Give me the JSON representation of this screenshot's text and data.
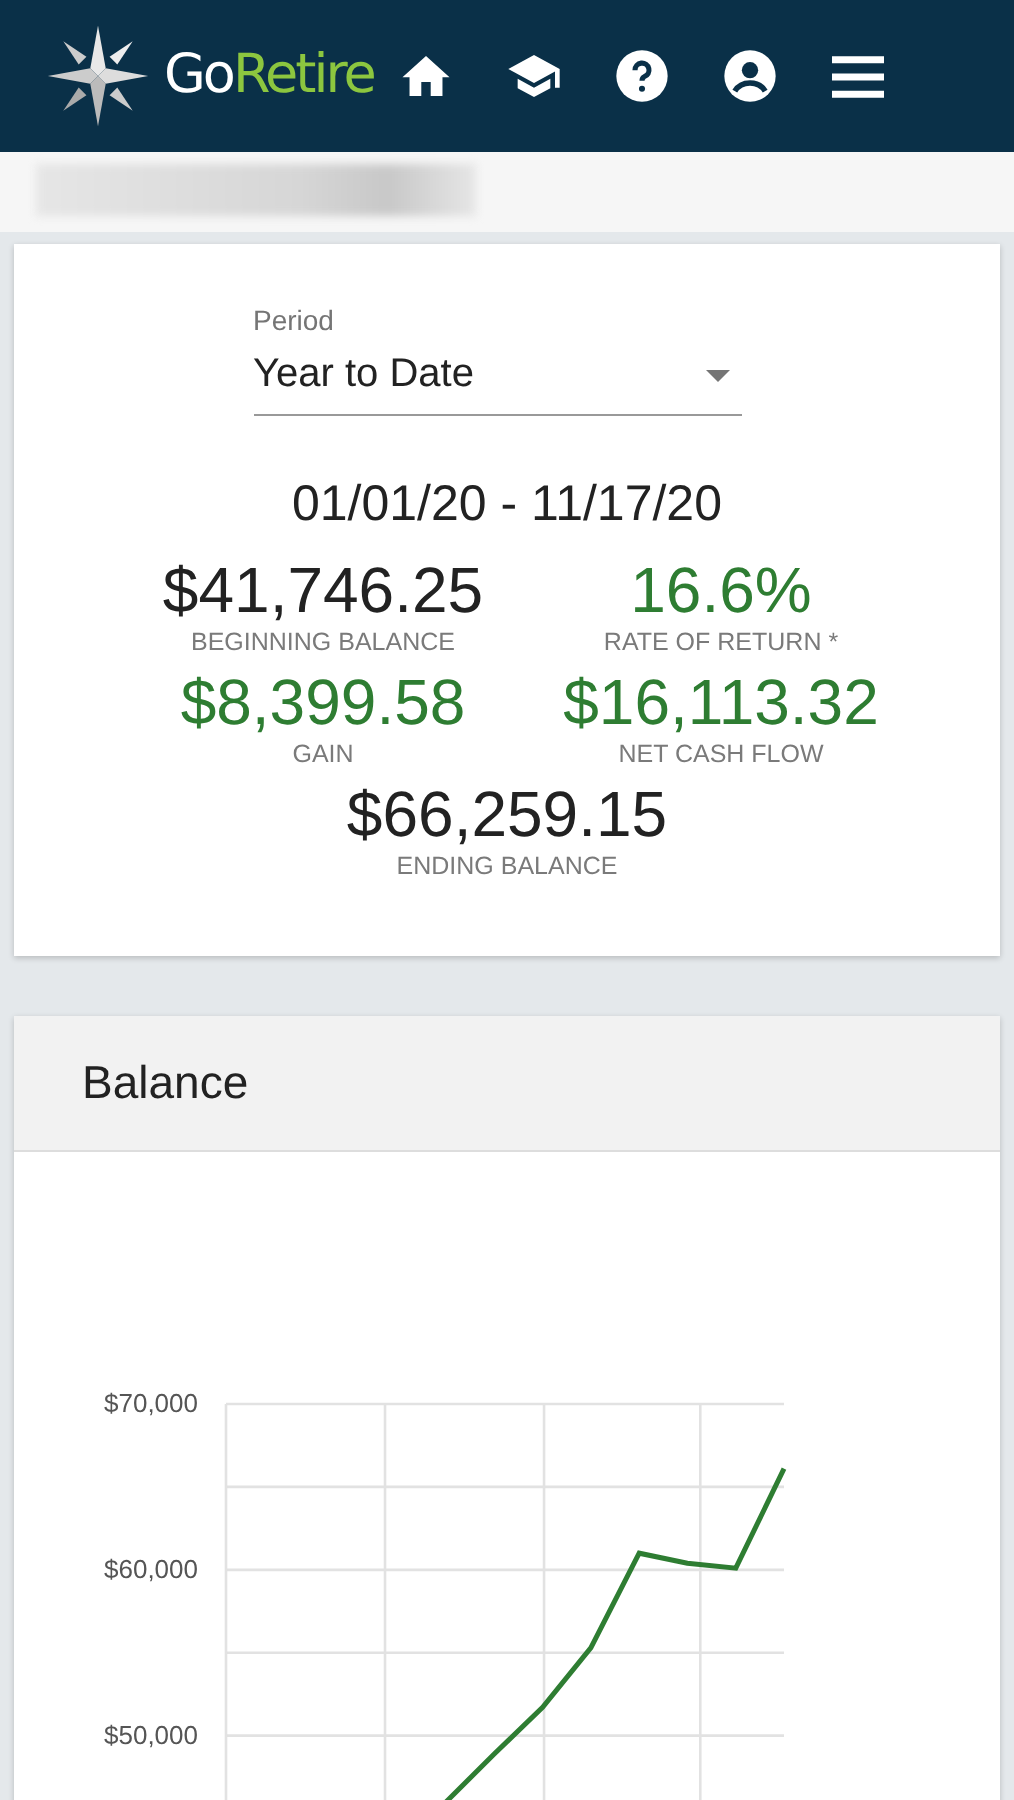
{
  "header": {
    "logo": {
      "first": "Go",
      "second": "Retire"
    },
    "nav": [
      {
        "kind": "home"
      },
      {
        "kind": "education"
      },
      {
        "kind": "help"
      },
      {
        "kind": "account"
      },
      {
        "kind": "menu"
      }
    ]
  },
  "summary": {
    "period": {
      "label": "Period",
      "value": "Year to Date"
    },
    "date_range": "01/01/20 - 11/17/20",
    "stats": [
      {
        "value": "$41,746.25",
        "label": "BEGINNING BALANCE",
        "positive": false
      },
      {
        "value": "16.6%",
        "label": "RATE OF RETURN *",
        "positive": true
      },
      {
        "value": "$8,399.58",
        "label": "GAIN",
        "positive": true
      },
      {
        "value": "$16,113.32",
        "label": "NET CASH FLOW",
        "positive": true
      },
      {
        "value": "$66,259.15",
        "label": "ENDING BALANCE",
        "positive": false
      }
    ]
  },
  "balance_card": {
    "chart_data": {
      "type": "line",
      "title": "Balance",
      "grid": true,
      "categories": [
        null,
        null,
        null,
        null,
        null,
        null,
        null,
        null
      ],
      "ylim": [
        46000,
        70000
      ],
      "yticks": [
        {
          "value": 50000,
          "label": "$50,000"
        },
        {
          "value": 60000,
          "label": "$60,000"
        },
        {
          "value": 70000,
          "label": "$70,000"
        }
      ],
      "series": [
        {
          "color": "#2e7d32",
          "values": [
            46000,
            48900,
            51700,
            55300,
            61000,
            60400,
            60100,
            66100
          ]
        }
      ]
    }
  }
}
